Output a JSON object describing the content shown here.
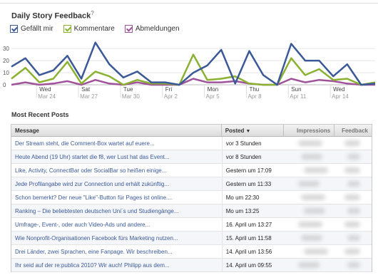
{
  "chart": {
    "title": "Daily Story Feedback",
    "title_sup": "?",
    "legend": [
      {
        "label": "Gefällt mir",
        "color": "#3b5998"
      },
      {
        "label": "Kommentare",
        "color": "#8bb131"
      },
      {
        "label": "Abmeldungen",
        "color": "#a0529b"
      }
    ]
  },
  "chart_data": {
    "type": "line",
    "y_ticks": [
      "30",
      "20",
      "10",
      "0"
    ],
    "ylim": [
      0,
      36
    ],
    "x_labels": [
      {
        "day": "Wed",
        "date": "Mar 24"
      },
      {
        "day": "Sat",
        "date": "Mar 27"
      },
      {
        "day": "Tue",
        "date": "Mar 30"
      },
      {
        "day": "Fri",
        "date": "Apr 2"
      },
      {
        "day": "Mon",
        "date": "Apr 5"
      },
      {
        "day": "Thu",
        "date": "Apr 8"
      },
      {
        "day": "Sun",
        "date": "Apr 11"
      },
      {
        "day": "Wed",
        "date": "Apr 14"
      }
    ],
    "x_label_indices": [
      2,
      5,
      8,
      11,
      14,
      17,
      20,
      23
    ],
    "series": [
      {
        "name": "Gefällt mir",
        "color": "#3b5998",
        "values": [
          15,
          22,
          8,
          12,
          24,
          5,
          35,
          17,
          6,
          11,
          2,
          2,
          0,
          10,
          16,
          29,
          1,
          28,
          8,
          0,
          34,
          20,
          20,
          7,
          17,
          0,
          1
        ]
      },
      {
        "name": "Kommentare",
        "color": "#8bb131",
        "values": [
          5,
          14,
          2,
          5,
          19,
          1,
          11,
          7,
          0,
          4,
          1,
          1,
          0,
          25,
          4,
          5,
          7,
          1,
          0,
          0,
          22,
          8,
          13,
          4,
          5,
          0,
          2
        ]
      },
      {
        "name": "Abmeldungen",
        "color": "#a0529b",
        "values": [
          0,
          2,
          0,
          1,
          3,
          0,
          4,
          1,
          0,
          2,
          0,
          0,
          0,
          5,
          2,
          2,
          3,
          1,
          0,
          0,
          5,
          2,
          4,
          3,
          1,
          0,
          0
        ]
      }
    ]
  },
  "posts": {
    "section_title": "Most Recent Posts",
    "headers": {
      "message": "Message",
      "posted": "Posted",
      "impressions": "Impressions",
      "feedback": "Feedback"
    },
    "sort_indicator": "▼",
    "rows": [
      {
        "message": "Der Stream steht, die Comment-Box wartet auf euere...",
        "posted": "vor 3 Stunden"
      },
      {
        "message": "Heute Abend (19 Uhr) startet die f8, wer Lust hat das Event...",
        "posted": "vor 8 Stunden"
      },
      {
        "message": "Like, Activity, ConnectBar oder SocialBar so heißen einige...",
        "posted": "Gestern um 17:09"
      },
      {
        "message": "Jede Profilangabe wird zur Connection und erhält zukünftig...",
        "posted": "Gestern um 11:33"
      },
      {
        "message": "Schon bemerkt? Der neue \"Like\"-Button für Pages ist online....",
        "posted": "Mo um 22:30"
      },
      {
        "message": "Ranking – Die beliebtesten deutschen Uni´s und Studiengänge...",
        "posted": "Mo um 13:25"
      },
      {
        "message": "Umfrage-, Event-, oder auch Video-Ads und andere...",
        "posted": "16. April um 13:27"
      },
      {
        "message": "Wie Nonprofit-Organisationen Facebook fürs Marketing nutzen...",
        "posted": "15. April um 11:58"
      },
      {
        "message": "Drei Länder, zwei Sprachen, eine Fanpage. Wir beschreiben...",
        "posted": "14. April um 13:56"
      },
      {
        "message": "Ihr seid auf der re:publica 2010? Wir auch! Philipp aus dem...",
        "posted": "14. April um 09:55"
      }
    ]
  }
}
